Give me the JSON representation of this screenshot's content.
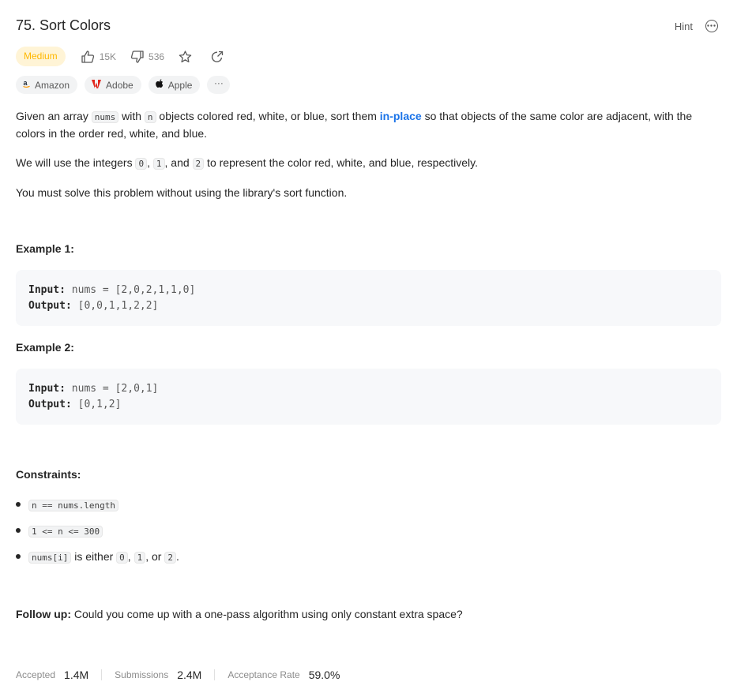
{
  "problem": {
    "title": "75. Sort Colors",
    "hint_label": "Hint",
    "difficulty": "Medium",
    "likes": "15K",
    "dislikes": "536"
  },
  "companies": [
    {
      "name": "Amazon",
      "icon": "amazon-icon"
    },
    {
      "name": "Adobe",
      "icon": "adobe-icon"
    },
    {
      "name": "Apple",
      "icon": "apple-icon"
    }
  ],
  "companies_more_label": "···",
  "description": {
    "p1_a": "Given an array ",
    "p1_code1": "nums",
    "p1_b": " with ",
    "p1_code2": "n",
    "p1_c": " objects colored red, white, or blue, sort them ",
    "p1_link": "in-place",
    "p1_d": " so that objects of the same color are adjacent, with the colors in the order red, white, and blue.",
    "p2_a": "We will use the integers ",
    "p2_code1": "0",
    "p2_b": ", ",
    "p2_code2": "1",
    "p2_c": ", and ",
    "p2_code3": "2",
    "p2_d": " to represent the color red, white, and blue, respectively.",
    "p3": "You must solve this problem without using the library's sort function."
  },
  "examples": [
    {
      "title": "Example 1:",
      "input_label": "Input:",
      "input": "nums = [2,0,2,1,1,0]",
      "output_label": "Output:",
      "output": "[0,0,1,1,2,2]"
    },
    {
      "title": "Example 2:",
      "input_label": "Input:",
      "input": "nums = [2,0,1]",
      "output_label": "Output:",
      "output": "[0,1,2]"
    }
  ],
  "constraints": {
    "title": "Constraints:",
    "c1": "n == nums.length",
    "c2": "1 <= n <= 300",
    "c3_code": "nums[i]",
    "c3_a": " is either ",
    "c3_code1": "0",
    "c3_b": ", ",
    "c3_code2": "1",
    "c3_c": ", or ",
    "c3_code3": "2",
    "c3_d": "."
  },
  "followup": {
    "label": "Follow up:",
    "text": " Could you come up with a one-pass algorithm using only constant extra space?"
  },
  "stats": {
    "accepted_label": "Accepted",
    "accepted_value": "1.4M",
    "submissions_label": "Submissions",
    "submissions_value": "2.4M",
    "rate_label": "Acceptance Rate",
    "rate_value": "59.0%"
  },
  "colors": {
    "medium_badge_bg": "#fff4d6",
    "medium_badge_text": "#ffb800",
    "link_blue": "#1a73e8"
  }
}
